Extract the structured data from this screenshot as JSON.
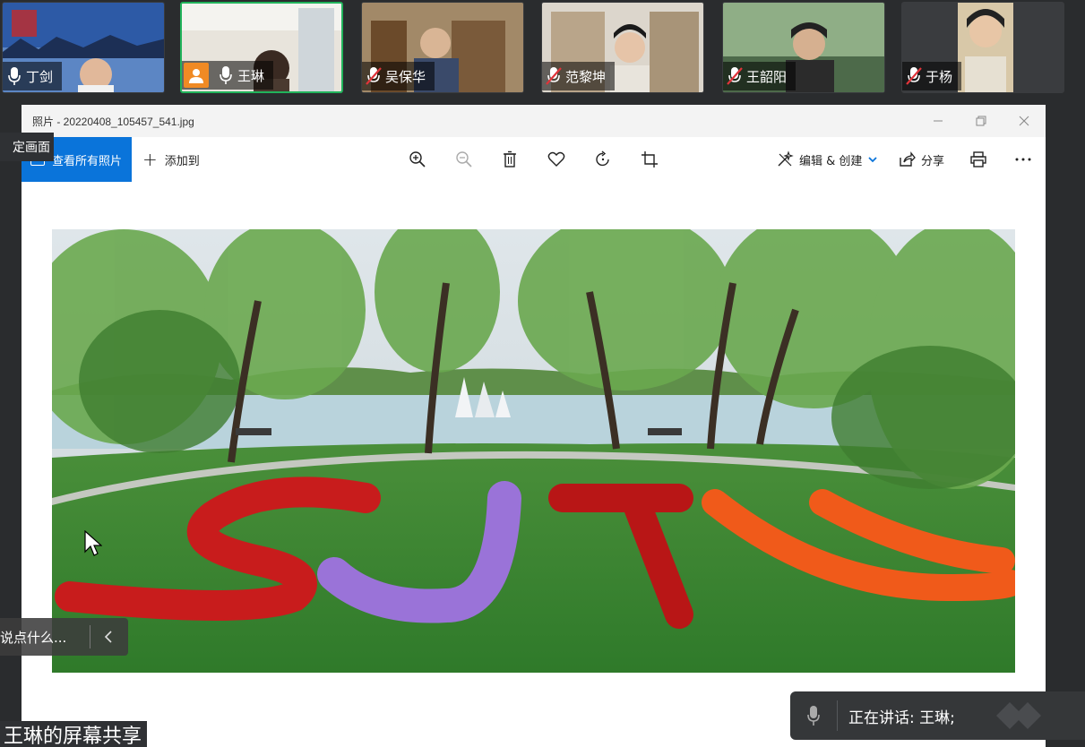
{
  "participants": [
    {
      "name": "丁剑",
      "muted": false,
      "active": false
    },
    {
      "name": "王琳",
      "muted": false,
      "active": true
    },
    {
      "name": "吴保华",
      "muted": true,
      "active": false
    },
    {
      "name": "范黎坤",
      "muted": true,
      "active": false
    },
    {
      "name": "王韶阳",
      "muted": true,
      "active": false
    },
    {
      "name": "于杨",
      "muted": true,
      "active": false
    }
  ],
  "photos_app": {
    "title": "照片 - 20220408_105457_541.jpg",
    "view_all_label": "查看所有照片",
    "add_to_label": "添加到",
    "edit_create_label": "编辑 & 创建",
    "share_label": "分享",
    "photo_text": "SJTU"
  },
  "overlays": {
    "lock_screen_label": "定画面",
    "chat_placeholder": "说点什么...",
    "screen_share_label": "王琳的屏幕共享",
    "speaking_label": "正在讲话: 王琳;"
  },
  "colors": {
    "accent_blue": "#0a74da",
    "active_green": "#21b35b",
    "avatar_orange": "#f08a24",
    "muted_red": "#e0343a"
  }
}
